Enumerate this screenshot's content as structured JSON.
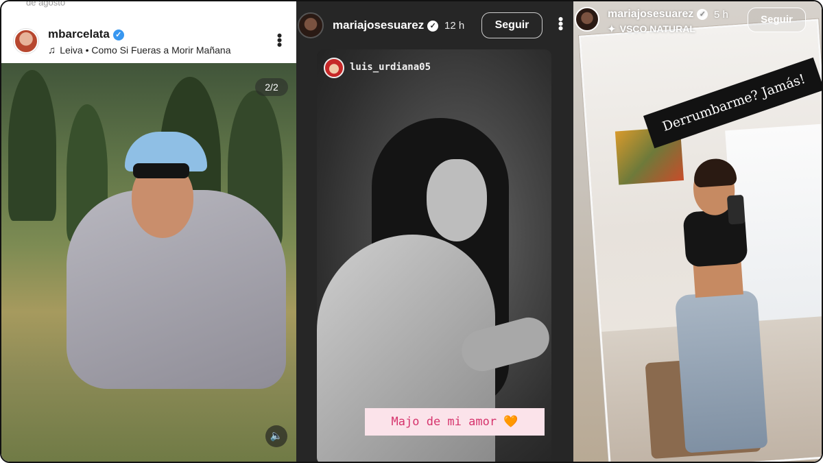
{
  "panels": [
    {
      "top_date": "de agosto",
      "username": "mbarcelata",
      "verified_mark": "✓",
      "music": "Leiva • Como Si Fueras a Morir Mañana",
      "slide_counter": "2/2",
      "icons": [
        "music-note-icon",
        "more-options-icon",
        "sound-icon"
      ]
    },
    {
      "username": "mariajosesuarez",
      "verified_mark": "✓",
      "time": "12 h",
      "follow_label": "Seguir",
      "mention": "luis_urdiana05",
      "caption": "Majo de mi amor 🧡",
      "icons": [
        "more-options-icon"
      ]
    },
    {
      "username": "mariajosesuarez",
      "verified_mark": "✓",
      "time": "5 h",
      "filter": "VSCO NATURAL",
      "follow_label": "Seguir",
      "overlay_text": "Derrumbarme? Jamás!",
      "icons": [
        "sparkle-icon"
      ]
    }
  ]
}
